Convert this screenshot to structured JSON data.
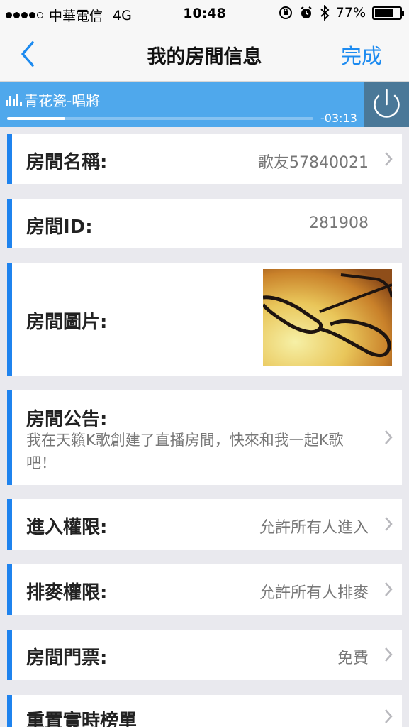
{
  "status_bar": {
    "carrier": "中華電信",
    "network": "4G",
    "time": "10:48",
    "battery": "77%",
    "battery_level": 0.77
  },
  "nav": {
    "title": "我的房間信息",
    "done_label": "完成",
    "accent_color": "#1d8bf0"
  },
  "player": {
    "song_title": "青花瓷-唱將",
    "time_remaining": "-03:13",
    "progress": 0.19,
    "bar_color": "#4fa8ec"
  },
  "rows": {
    "room_name": {
      "label": "房間名稱:",
      "value": "歌友57840021"
    },
    "room_id": {
      "label": "房間ID:",
      "value": "281908"
    },
    "room_image": {
      "label": "房間圖片:"
    },
    "announcement": {
      "label": "房間公告:",
      "text": "我在天籟K歌創建了直播房間，快來和我一起K歌吧！"
    },
    "entry_permission": {
      "label": "進入權限:",
      "value": "允許所有人進入"
    },
    "queue_permission": {
      "label": "排麥權限:",
      "value": "允許所有人排麥"
    },
    "ticket": {
      "label": "房間門票:",
      "value": "免費"
    },
    "reset_ranking": {
      "label": "重置實時榜單"
    }
  }
}
